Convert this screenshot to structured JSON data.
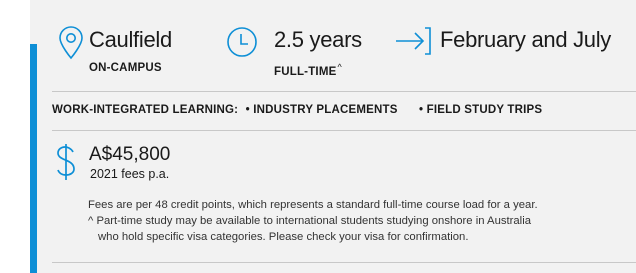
{
  "colors": {
    "accent": "#0e8fd6",
    "card_bg": "#f2f2f2",
    "divider": "#c8c8c8"
  },
  "location": {
    "icon": "location-pin-icon",
    "title": "Caulfield",
    "subtitle": "ON-CAMPUS"
  },
  "duration": {
    "icon": "clock-icon",
    "title": "2.5 years",
    "subtitle": "FULL-TIME",
    "footnote_mark": "^"
  },
  "intake": {
    "icon": "arrow-into-bracket-icon",
    "title": "February and July"
  },
  "wil": {
    "label": "WORK-INTEGRATED LEARNING:",
    "items": [
      "• INDUSTRY PLACEMENTS",
      "• FIELD STUDY TRIPS"
    ]
  },
  "fees": {
    "icon": "dollar-icon",
    "amount": "A$45,800",
    "year_note": "2021 fees p.a.",
    "notes": [
      "Fees are per 48 credit points, which represents a standard full-time course load for a year.",
      "^ Part-time study may be available to international students studying onshore in Australia",
      "who hold specific visa categories. Please check your visa for confirmation."
    ]
  }
}
